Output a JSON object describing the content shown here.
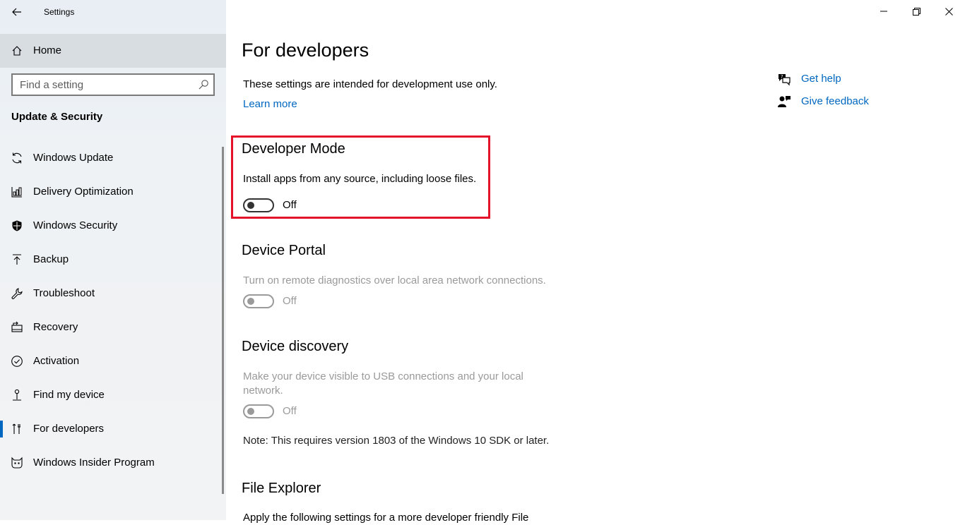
{
  "window": {
    "title": "Settings"
  },
  "sidebar": {
    "home_label": "Home",
    "search_placeholder": "Find a setting",
    "section_title": "Update & Security",
    "items": [
      {
        "label": "Windows Update",
        "icon": "sync-icon"
      },
      {
        "label": "Delivery Optimization",
        "icon": "delivery-optimization-icon"
      },
      {
        "label": "Windows Security",
        "icon": "shield-icon"
      },
      {
        "label": "Backup",
        "icon": "backup-icon"
      },
      {
        "label": "Troubleshoot",
        "icon": "wrench-icon"
      },
      {
        "label": "Recovery",
        "icon": "recovery-icon"
      },
      {
        "label": "Activation",
        "icon": "check-circle-icon"
      },
      {
        "label": "Find my device",
        "icon": "person-pin-icon"
      },
      {
        "label": "For developers",
        "icon": "developer-tools-icon",
        "selected": true
      },
      {
        "label": "Windows Insider Program",
        "icon": "insider-cat-icon"
      }
    ]
  },
  "main": {
    "title": "For developers",
    "intro": "These settings are intended for development use only.",
    "learn_more": "Learn more",
    "developer_mode": {
      "title": "Developer Mode",
      "description": "Install apps from any source, including loose files.",
      "state": "Off"
    },
    "device_portal": {
      "title": "Device Portal",
      "description": "Turn on remote diagnostics over local area network connections.",
      "state": "Off"
    },
    "device_discovery": {
      "title": "Device discovery",
      "description_line1": "Make your device visible to USB connections and your local",
      "description_line2": "network.",
      "state": "Off",
      "note": "Note: This requires version 1803 of the Windows 10 SDK or later."
    },
    "file_explorer": {
      "title": "File Explorer",
      "description": "Apply the following settings for a more developer friendly File"
    }
  },
  "help": {
    "get_help": "Get help",
    "give_feedback": "Give feedback"
  },
  "colors": {
    "accent": "#0067c0",
    "highlight": "#e5132a",
    "disabled_text": "#9a9a9a"
  }
}
